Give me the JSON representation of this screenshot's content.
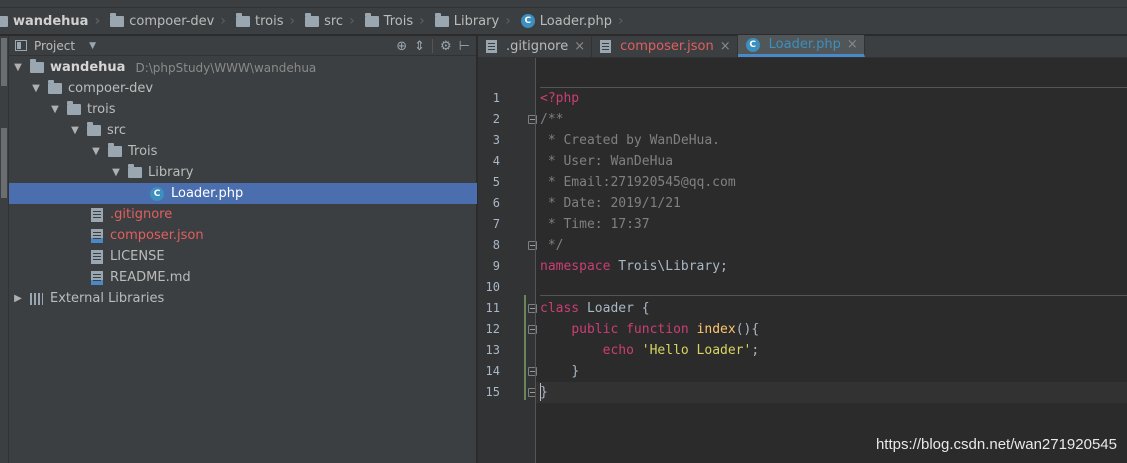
{
  "breadcrumb": [
    {
      "label": "wandehua",
      "kind": "folder",
      "bold": true
    },
    {
      "label": "compoer-dev",
      "kind": "folder"
    },
    {
      "label": "trois",
      "kind": "folder"
    },
    {
      "label": "src",
      "kind": "folder"
    },
    {
      "label": "Trois",
      "kind": "folder"
    },
    {
      "label": "Library",
      "kind": "folder"
    },
    {
      "label": "Loader.php",
      "kind": "class-file"
    }
  ],
  "project_panel": {
    "title": "Project",
    "root": {
      "label": "wandehua",
      "path": "D:\\phpStudy\\WWW\\wandehua"
    },
    "tree": [
      {
        "label": "compoer-dev",
        "kind": "folder"
      },
      {
        "label": "trois",
        "kind": "folder"
      },
      {
        "label": "src",
        "kind": "folder"
      },
      {
        "label": "Trois",
        "kind": "folder"
      },
      {
        "label": "Library",
        "kind": "folder"
      },
      {
        "label": "Loader.php",
        "kind": "class-file",
        "selected": true
      },
      {
        "label": ".gitignore",
        "kind": "file",
        "color": "#e05f5f"
      },
      {
        "label": "composer.json",
        "kind": "json-file",
        "color": "#e05f5f"
      },
      {
        "label": "LICENSE",
        "kind": "file"
      },
      {
        "label": "README.md",
        "kind": "md-file"
      },
      {
        "label": "External Libraries",
        "kind": "library"
      }
    ]
  },
  "tabs": [
    {
      "label": ".gitignore",
      "close": "×",
      "active": false
    },
    {
      "label": "composer.json",
      "close": "×",
      "active": false
    },
    {
      "label": "Loader.php",
      "close": "×",
      "active": true
    }
  ],
  "code": {
    "line_numbers": [
      "1",
      "2",
      "3",
      "4",
      "5",
      "6",
      "7",
      "8",
      "9",
      "10",
      "11",
      "12",
      "13",
      "14",
      "15"
    ],
    "php_open": "<?php",
    "doc_open": "/**",
    "doc_created": " * Created by WanDeHua.",
    "doc_user": " * User: WanDeHua",
    "doc_email": " * Email:271920545@qq.com",
    "doc_date": " * Date: 2019/1/21",
    "doc_time": " * Time: 17:37",
    "doc_close": " */",
    "kw_namespace": "namespace",
    "namespace_name": " Trois\\Library;",
    "kw_class": "class",
    "class_name": " Loader {",
    "kw_public": "public",
    "kw_function": "function",
    "fn_name": "index",
    "fn_parens": "(){",
    "kw_echo": "echo",
    "str_hello": "'Hello Loader'",
    "semicolon": ";",
    "brace_close": "}"
  },
  "watermark": "https://blog.csdn.net/wan271920545",
  "colors": {
    "keyword": "#cc3e73",
    "comment": "#808080",
    "function": "#ffc66d",
    "string": "#d8d460",
    "selection": "#4b6eaf"
  }
}
